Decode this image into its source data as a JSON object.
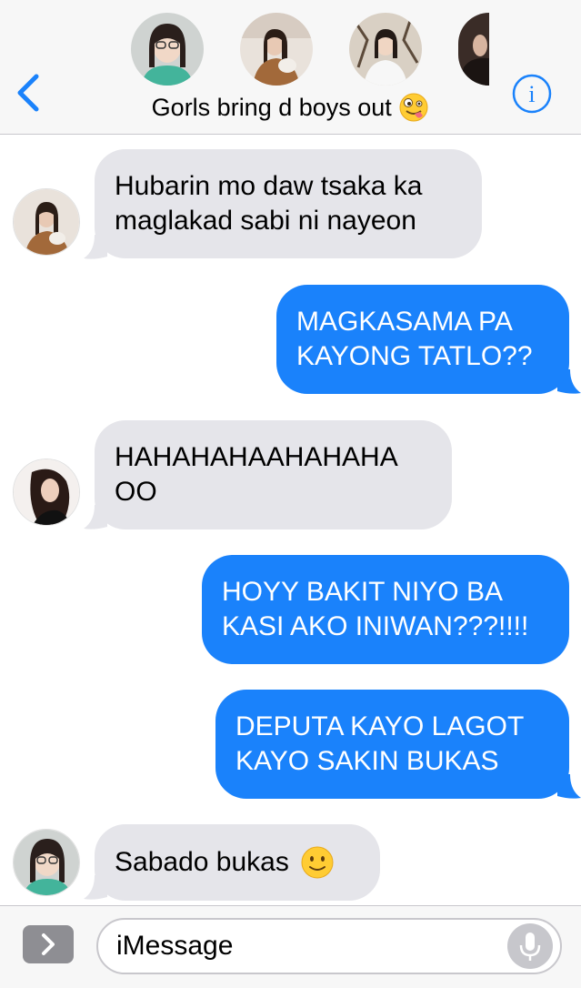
{
  "header": {
    "group_name": "Gorls bring d boys out",
    "group_emoji_icon": "zany-face-emoji",
    "back_icon": "chevron-left-icon",
    "info_icon": "info-icon",
    "accent_color": "#1a82fb"
  },
  "messages": [
    {
      "direction": "incoming",
      "lines": [
        "Hubarin mo daw tsaka ka",
        "maglakad sabi ni nayeon"
      ]
    },
    {
      "direction": "outgoing",
      "lines": [
        "MAGKASAMA PA",
        "KAYONG TATLO??"
      ]
    },
    {
      "direction": "incoming",
      "lines": [
        "HAHAHAHAAHAHAHA",
        "OO"
      ]
    },
    {
      "direction": "outgoing",
      "lines": [
        "HOYY BAKIT NIYO BA",
        "KASI AKO INIWAN???!!!!"
      ]
    },
    {
      "direction": "outgoing",
      "lines": [
        "DEPUTA KAYO LAGOT",
        "KAYO SAKIN BUKAS"
      ]
    },
    {
      "direction": "incoming",
      "lines": [
        "Sabado bukas"
      ],
      "emoji_icon": "slightly-smiling-face-emoji"
    }
  ],
  "input": {
    "placeholder": "iMessage",
    "apps_icon": "chevron-right-icon",
    "mic_icon": "microphone-icon"
  },
  "colors": {
    "incoming_bubble": "#e5e5ea",
    "outgoing_bubble": "#1a82fb"
  }
}
